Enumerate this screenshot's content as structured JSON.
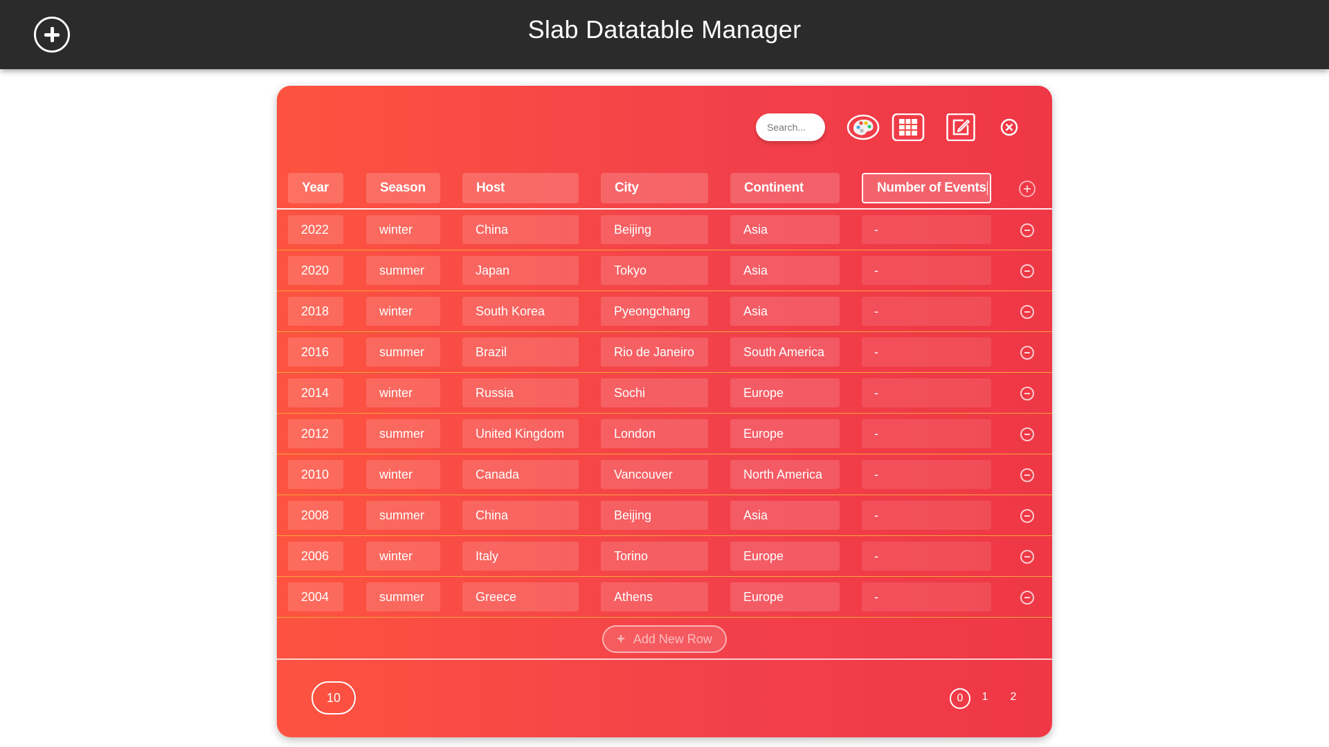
{
  "app": {
    "title": "Slab Datatable Manager"
  },
  "toolbar": {
    "search_placeholder": "Search...",
    "icons": [
      "palette-icon",
      "grid-icon",
      "edit-icon",
      "close-icon"
    ]
  },
  "table": {
    "columns": [
      "Year",
      "Season",
      "Host",
      "City",
      "Continent",
      "Number of Events"
    ],
    "rows": [
      [
        "2022",
        "winter",
        "China",
        "Beijing",
        "Asia",
        "-"
      ],
      [
        "2020",
        "summer",
        "Japan",
        "Tokyo",
        "Asia",
        "-"
      ],
      [
        "2018",
        "winter",
        "South Korea",
        "Pyeongchang",
        "Asia",
        "-"
      ],
      [
        "2016",
        "summer",
        "Brazil",
        "Rio de Janeiro",
        "South America",
        "-"
      ],
      [
        "2014",
        "winter",
        "Russia",
        "Sochi",
        "Europe",
        "-"
      ],
      [
        "2012",
        "summer",
        "United Kingdom",
        "London",
        "Europe",
        "-"
      ],
      [
        "2010",
        "winter",
        "Canada",
        "Vancouver",
        "North America",
        "-"
      ],
      [
        "2008",
        "summer",
        "China",
        "Beijing",
        "Asia",
        "-"
      ],
      [
        "2006",
        "winter",
        "Italy",
        "Torino",
        "Europe",
        "-"
      ],
      [
        "2004",
        "summer",
        "Greece",
        "Athens",
        "Europe",
        "-"
      ]
    ],
    "add_row_label": "Add New Row",
    "add_row_symbol": "+"
  },
  "footer": {
    "page_size": "10",
    "pages": [
      "0",
      "1",
      "2"
    ],
    "current_page": "0"
  },
  "colors": {
    "topbar": "#2b2b2b",
    "card_gradient_start": "#fd5340",
    "card_gradient_end": "#ef3745",
    "row_divider": "#f7a63a"
  }
}
